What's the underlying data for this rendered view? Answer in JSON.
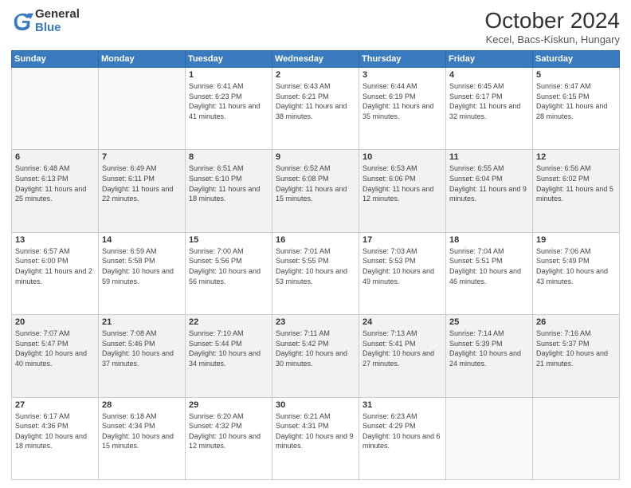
{
  "header": {
    "logo_general": "General",
    "logo_blue": "Blue",
    "title": "October 2024",
    "location": "Kecel, Bacs-Kiskun, Hungary"
  },
  "days_of_week": [
    "Sunday",
    "Monday",
    "Tuesday",
    "Wednesday",
    "Thursday",
    "Friday",
    "Saturday"
  ],
  "weeks": [
    [
      {
        "day": "",
        "info": ""
      },
      {
        "day": "",
        "info": ""
      },
      {
        "day": "1",
        "info": "Sunrise: 6:41 AM\nSunset: 6:23 PM\nDaylight: 11 hours and 41 minutes."
      },
      {
        "day": "2",
        "info": "Sunrise: 6:43 AM\nSunset: 6:21 PM\nDaylight: 11 hours and 38 minutes."
      },
      {
        "day": "3",
        "info": "Sunrise: 6:44 AM\nSunset: 6:19 PM\nDaylight: 11 hours and 35 minutes."
      },
      {
        "day": "4",
        "info": "Sunrise: 6:45 AM\nSunset: 6:17 PM\nDaylight: 11 hours and 32 minutes."
      },
      {
        "day": "5",
        "info": "Sunrise: 6:47 AM\nSunset: 6:15 PM\nDaylight: 11 hours and 28 minutes."
      }
    ],
    [
      {
        "day": "6",
        "info": "Sunrise: 6:48 AM\nSunset: 6:13 PM\nDaylight: 11 hours and 25 minutes."
      },
      {
        "day": "7",
        "info": "Sunrise: 6:49 AM\nSunset: 6:11 PM\nDaylight: 11 hours and 22 minutes."
      },
      {
        "day": "8",
        "info": "Sunrise: 6:51 AM\nSunset: 6:10 PM\nDaylight: 11 hours and 18 minutes."
      },
      {
        "day": "9",
        "info": "Sunrise: 6:52 AM\nSunset: 6:08 PM\nDaylight: 11 hours and 15 minutes."
      },
      {
        "day": "10",
        "info": "Sunrise: 6:53 AM\nSunset: 6:06 PM\nDaylight: 11 hours and 12 minutes."
      },
      {
        "day": "11",
        "info": "Sunrise: 6:55 AM\nSunset: 6:04 PM\nDaylight: 11 hours and 9 minutes."
      },
      {
        "day": "12",
        "info": "Sunrise: 6:56 AM\nSunset: 6:02 PM\nDaylight: 11 hours and 5 minutes."
      }
    ],
    [
      {
        "day": "13",
        "info": "Sunrise: 6:57 AM\nSunset: 6:00 PM\nDaylight: 11 hours and 2 minutes."
      },
      {
        "day": "14",
        "info": "Sunrise: 6:59 AM\nSunset: 5:58 PM\nDaylight: 10 hours and 59 minutes."
      },
      {
        "day": "15",
        "info": "Sunrise: 7:00 AM\nSunset: 5:56 PM\nDaylight: 10 hours and 56 minutes."
      },
      {
        "day": "16",
        "info": "Sunrise: 7:01 AM\nSunset: 5:55 PM\nDaylight: 10 hours and 53 minutes."
      },
      {
        "day": "17",
        "info": "Sunrise: 7:03 AM\nSunset: 5:53 PM\nDaylight: 10 hours and 49 minutes."
      },
      {
        "day": "18",
        "info": "Sunrise: 7:04 AM\nSunset: 5:51 PM\nDaylight: 10 hours and 46 minutes."
      },
      {
        "day": "19",
        "info": "Sunrise: 7:06 AM\nSunset: 5:49 PM\nDaylight: 10 hours and 43 minutes."
      }
    ],
    [
      {
        "day": "20",
        "info": "Sunrise: 7:07 AM\nSunset: 5:47 PM\nDaylight: 10 hours and 40 minutes."
      },
      {
        "day": "21",
        "info": "Sunrise: 7:08 AM\nSunset: 5:46 PM\nDaylight: 10 hours and 37 minutes."
      },
      {
        "day": "22",
        "info": "Sunrise: 7:10 AM\nSunset: 5:44 PM\nDaylight: 10 hours and 34 minutes."
      },
      {
        "day": "23",
        "info": "Sunrise: 7:11 AM\nSunset: 5:42 PM\nDaylight: 10 hours and 30 minutes."
      },
      {
        "day": "24",
        "info": "Sunrise: 7:13 AM\nSunset: 5:41 PM\nDaylight: 10 hours and 27 minutes."
      },
      {
        "day": "25",
        "info": "Sunrise: 7:14 AM\nSunset: 5:39 PM\nDaylight: 10 hours and 24 minutes."
      },
      {
        "day": "26",
        "info": "Sunrise: 7:16 AM\nSunset: 5:37 PM\nDaylight: 10 hours and 21 minutes."
      }
    ],
    [
      {
        "day": "27",
        "info": "Sunrise: 6:17 AM\nSunset: 4:36 PM\nDaylight: 10 hours and 18 minutes."
      },
      {
        "day": "28",
        "info": "Sunrise: 6:18 AM\nSunset: 4:34 PM\nDaylight: 10 hours and 15 minutes."
      },
      {
        "day": "29",
        "info": "Sunrise: 6:20 AM\nSunset: 4:32 PM\nDaylight: 10 hours and 12 minutes."
      },
      {
        "day": "30",
        "info": "Sunrise: 6:21 AM\nSunset: 4:31 PM\nDaylight: 10 hours and 9 minutes."
      },
      {
        "day": "31",
        "info": "Sunrise: 6:23 AM\nSunset: 4:29 PM\nDaylight: 10 hours and 6 minutes."
      },
      {
        "day": "",
        "info": ""
      },
      {
        "day": "",
        "info": ""
      }
    ]
  ]
}
